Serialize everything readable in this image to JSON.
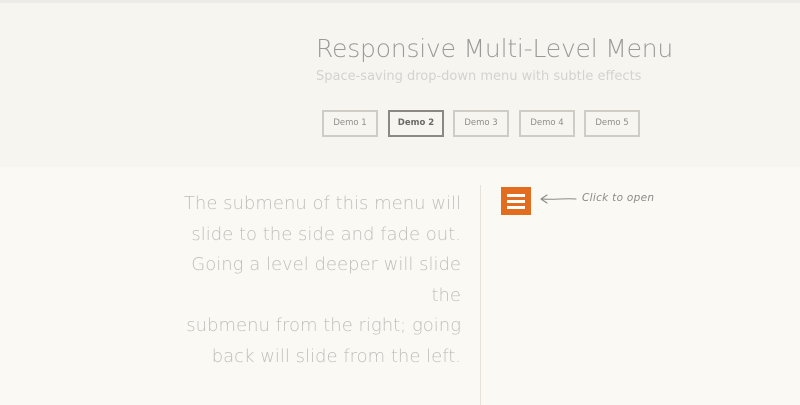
{
  "header": {
    "title": "Responsive Multi-Level Menu",
    "subtitle": "Space-saving drop-down menu with subtle effects"
  },
  "demos": [
    {
      "label": "Demo 1",
      "active": false
    },
    {
      "label": "Demo 2",
      "active": true
    },
    {
      "label": "Demo 3",
      "active": false
    },
    {
      "label": "Demo 4",
      "active": false
    },
    {
      "label": "Demo 5",
      "active": false
    }
  ],
  "description_lines": [
    "The submenu of this menu will",
    "slide to the side and fade out.",
    "Going a level deeper will slide the",
    "submenu from the right; going",
    "back will slide from the left."
  ],
  "menu_button": {
    "icon": "hamburger-menu-icon",
    "color": "#e36d1f"
  },
  "hint": {
    "text": "Click to open",
    "icon": "left-arrow-icon"
  }
}
